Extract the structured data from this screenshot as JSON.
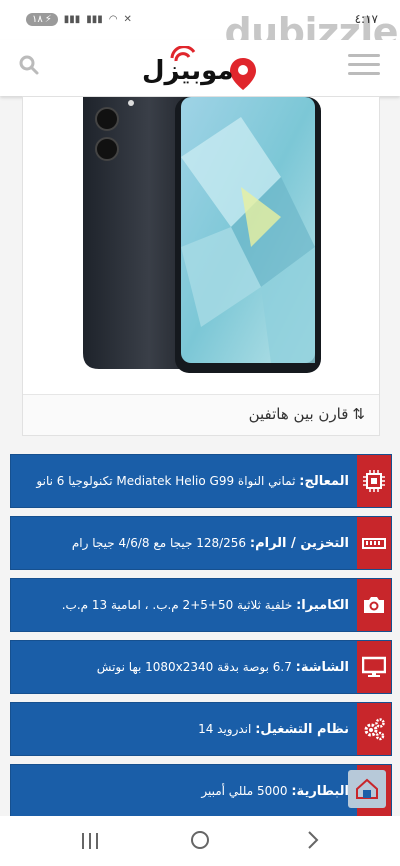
{
  "status_bar": {
    "battery": "١٨",
    "time": "٤:١٧"
  },
  "watermark": "dubizzle",
  "header": {
    "logo_text": "موبيزل"
  },
  "product": {
    "compare_label": "قارن بين هاتفين"
  },
  "specs": [
    {
      "label": "المعالج:",
      "value": "ثماني النواة Mediatek Helio G99 تكنولوجيا 6 نانو",
      "icon": "chip-icon"
    },
    {
      "label": "التخزين / الرام:",
      "value": "128/256 جيجا مع 4/6/8 جيجا رام",
      "icon": "memory-icon"
    },
    {
      "label": "الكاميرا:",
      "value": "خلفية ثلاثية 50+5+2 م.ب. ، امامية 13 م.ب.",
      "icon": "camera-icon"
    },
    {
      "label": "الشاشة:",
      "value": "6.7 بوصة بدقة 1080x2340 بها نوتش",
      "icon": "monitor-icon"
    },
    {
      "label": "نظام التشغيل:",
      "value": "اندرويد 14",
      "icon": "gears-icon"
    },
    {
      "label": "البطارية:",
      "value": "5000 مللي أمبير",
      "icon": "battery-icon"
    }
  ],
  "colors": {
    "spec_bg": "#1a5ea8",
    "icon_bg": "#c8262b",
    "logo_red": "#e0262c"
  }
}
